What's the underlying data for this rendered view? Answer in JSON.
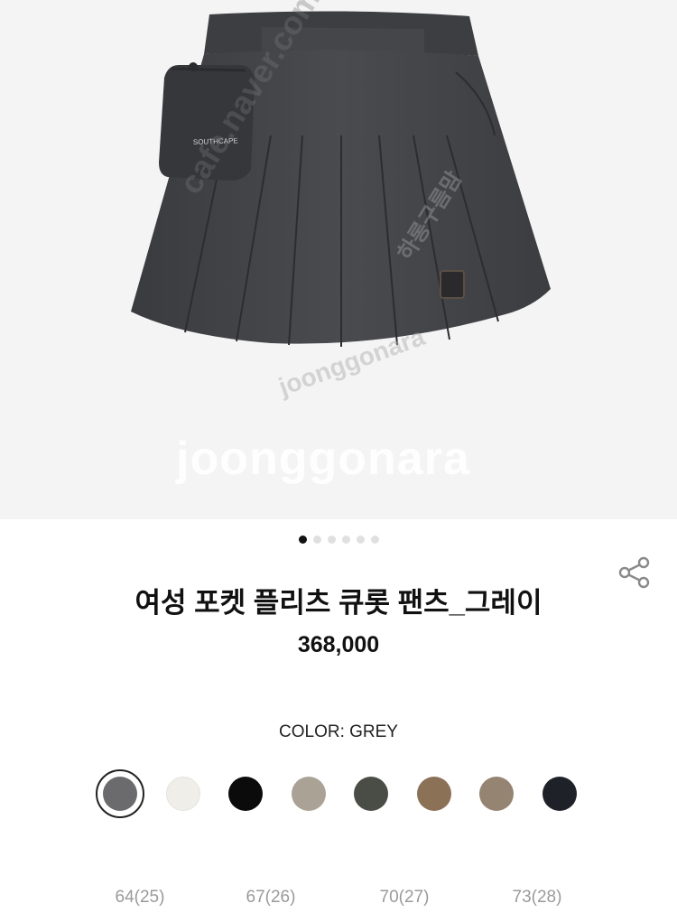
{
  "product": {
    "brand_tag": "SOUTHCAPE",
    "title": "여성 포켓 플리츠 큐롯 팬츠_그레이",
    "price": "368,000"
  },
  "gallery": {
    "image_count": 6,
    "active_index": 0,
    "watermarks": {
      "url": "cafe.naver.com/joonggonara",
      "big": "joonggonara",
      "korean": "하롱구름맘",
      "small": "joonggonara"
    }
  },
  "color": {
    "label": "COLOR: GREY",
    "swatches": [
      {
        "name": "grey",
        "hex": "#6b6b6e",
        "selected": true
      },
      {
        "name": "ivory",
        "hex": "#efeee9",
        "selected": false
      },
      {
        "name": "black",
        "hex": "#0b0b0b",
        "selected": false
      },
      {
        "name": "beige",
        "hex": "#aaa294",
        "selected": false
      },
      {
        "name": "dark-green",
        "hex": "#4a4d45",
        "selected": false
      },
      {
        "name": "brown",
        "hex": "#8b7156",
        "selected": false
      },
      {
        "name": "taupe",
        "hex": "#958472",
        "selected": false
      },
      {
        "name": "navy",
        "hex": "#1e2228",
        "selected": false
      }
    ]
  },
  "sizes": [
    "64(25)",
    "67(26)",
    "70(27)",
    "73(28)"
  ],
  "icons": {
    "share": "share-icon"
  }
}
